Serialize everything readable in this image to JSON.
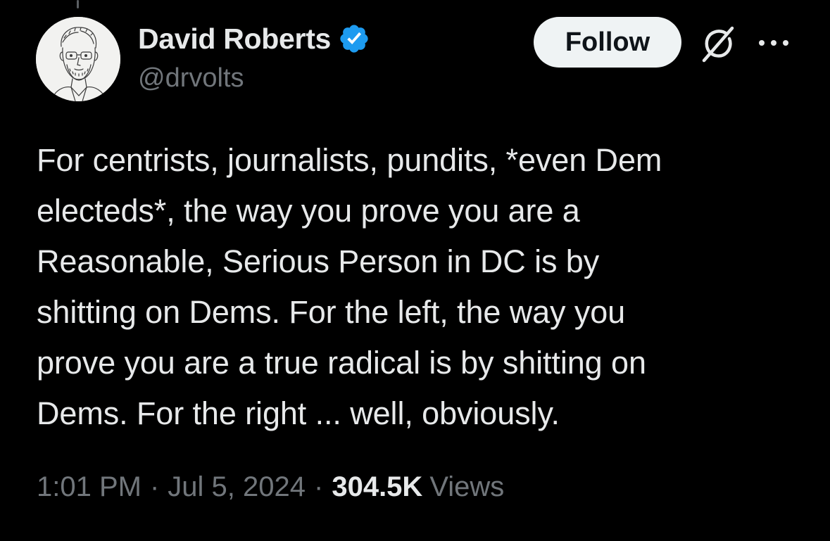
{
  "author": {
    "display_name": "David Roberts",
    "handle": "@drvolts",
    "verified": true,
    "verified_color": "#1d9bf0",
    "avatar_icon": "sketch-portrait-avatar"
  },
  "actions": {
    "follow_label": "Follow",
    "grok_icon": "grok-icon",
    "more_icon": "more-dots-icon"
  },
  "tweet": {
    "text": "For centrists, journalists, pundits, *even Dem\nelecteds*, the way you prove you are a\nReasonable, Serious Person in DC is by\nshitting on Dems. For the left, the way you\nprove you are a true radical is by shitting on\nDems. For the right ... well, obviously.",
    "time": "1:01 PM",
    "separator": "·",
    "date": "Jul 5, 2024",
    "views_count": "304.5K",
    "views_label": "Views"
  },
  "colors": {
    "background": "#000000",
    "primary_text": "#e7e9ea",
    "secondary_text": "#71767b",
    "follow_bg": "#eff3f4",
    "follow_text": "#0f1419"
  }
}
